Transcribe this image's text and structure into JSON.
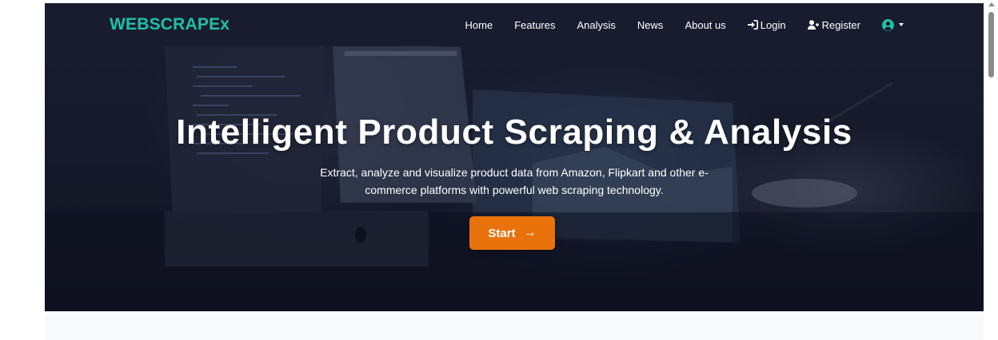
{
  "nav": {
    "brand": "WEBSCRAPEx",
    "links": [
      "Home",
      "Features",
      "Analysis",
      "News",
      "About us"
    ],
    "login": "Login",
    "register": "Register",
    "login_icon": "sign-in-icon",
    "register_icon": "user-plus-icon",
    "user_icon": "user-circle-icon"
  },
  "hero": {
    "title": "Intelligent Product Scraping & Analysis",
    "subtitle_line1": "Extract, analyze and visualize product data from Amazon, Flipkart and other e-",
    "subtitle_line2": "commerce platforms with powerful web scraping technology.",
    "button_label": "Start",
    "button_icon": "arrow-right-icon"
  },
  "colors": {
    "brand": "#1fc0a8",
    "nav_bg": "#191c2e",
    "button": "#e8720c"
  }
}
